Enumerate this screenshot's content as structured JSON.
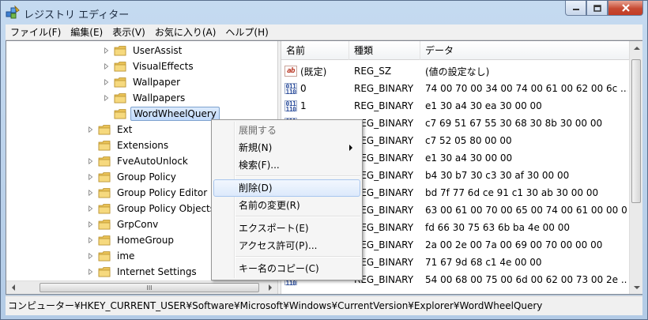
{
  "window": {
    "title": "レジストリ エディター",
    "close_icon": "close-icon",
    "min_icon": "minimize-icon",
    "max_icon": "maximize-icon"
  },
  "menubar": [
    "ファイル(F)",
    "編集(E)",
    "表示(V)",
    "お気に入り(A)",
    "ヘルプ(H)"
  ],
  "tree": {
    "items": [
      {
        "label": "UserAssist",
        "expandable": true,
        "level": 2
      },
      {
        "label": "VisualEffects",
        "expandable": true,
        "level": 2
      },
      {
        "label": "Wallpaper",
        "expandable": true,
        "level": 2
      },
      {
        "label": "Wallpapers",
        "expandable": true,
        "level": 2
      },
      {
        "label": "WordWheelQuery",
        "expandable": false,
        "level": 2,
        "selected": true
      },
      {
        "label": "Ext",
        "expandable": true,
        "level": 1
      },
      {
        "label": "Extensions",
        "expandable": false,
        "level": 1
      },
      {
        "label": "FveAutoUnlock",
        "expandable": true,
        "level": 1
      },
      {
        "label": "Group Policy",
        "expandable": true,
        "level": 1
      },
      {
        "label": "Group Policy Editor",
        "expandable": true,
        "level": 1
      },
      {
        "label": "Group Policy Objects",
        "expandable": true,
        "level": 1
      },
      {
        "label": "GrpConv",
        "expandable": true,
        "level": 1
      },
      {
        "label": "HomeGroup",
        "expandable": true,
        "level": 1
      },
      {
        "label": "ime",
        "expandable": true,
        "level": 1
      },
      {
        "label": "Internet Settings",
        "expandable": true,
        "level": 1
      }
    ],
    "hscroll_thumb_glyph": "III"
  },
  "list": {
    "columns": [
      "名前",
      "種類",
      "データ"
    ],
    "rows": [
      {
        "name": "(既定)",
        "type": "REG_SZ",
        "data": "(値の設定なし)",
        "icon": "string-value-icon"
      },
      {
        "name": "0",
        "type": "REG_BINARY",
        "data": "74 00 70 00 34 00 74 00 61 00 62 00 6c ...",
        "icon": "binary-value-icon"
      },
      {
        "name": "1",
        "type": "REG_BINARY",
        "data": "e1 30 a4 30 ea 30 00 00",
        "icon": "binary-value-icon"
      },
      {
        "name": "",
        "type": "REG_BINARY",
        "data": "c7 69 51 67 55 30 68 30 8b 30 00 00",
        "icon": "binary-value-icon"
      },
      {
        "name": "",
        "type": "REG_BINARY",
        "data": "c7 52 05 80 00 00",
        "icon": "binary-value-icon"
      },
      {
        "name": "",
        "type": "REG_BINARY",
        "data": "e1 30 a4 30 00 00",
        "icon": "binary-value-icon"
      },
      {
        "name": "",
        "type": "REG_BINARY",
        "data": "b4 30 b7 30 c3 30 af 30 00 00",
        "icon": "binary-value-icon"
      },
      {
        "name": "",
        "type": "REG_BINARY",
        "data": "bd 7f 77 6d ce 91 c1 30 ab 30 00 00",
        "icon": "binary-value-icon"
      },
      {
        "name": "",
        "type": "REG_BINARY",
        "data": "63 00 61 00 70 00 65 00 74 00 61 00 00 00",
        "icon": "binary-value-icon"
      },
      {
        "name": "",
        "type": "REG_BINARY",
        "data": "fd 66 30 75 63 6b ba 4e 00 00",
        "icon": "binary-value-icon"
      },
      {
        "name": "",
        "type": "REG_BINARY",
        "data": "2a 00 2e 00 7a 00 69 00 70 00 00 00",
        "icon": "binary-value-icon"
      },
      {
        "name": "",
        "type": "REG_BINARY",
        "data": "71 67 9d 68 c1 4e 00 00",
        "icon": "binary-value-icon"
      },
      {
        "name": "",
        "type": "REG_BINARY",
        "data": "54 00 68 00 75 00 6d 00 62 00 73 00 2e ...",
        "icon": "binary-value-icon"
      }
    ]
  },
  "context_menu": {
    "items": [
      {
        "label": "展開する",
        "disabled": true
      },
      {
        "label": "新規(N)",
        "submenu": true
      },
      {
        "label": "検索(F)..."
      },
      {
        "separator": true
      },
      {
        "label": "削除(D)",
        "hover": true
      },
      {
        "label": "名前の変更(R)"
      },
      {
        "separator": true
      },
      {
        "label": "エクスポート(E)"
      },
      {
        "label": "アクセス許可(P)..."
      },
      {
        "separator": true
      },
      {
        "label": "キー名のコピー(C)"
      }
    ]
  },
  "statusbar": {
    "path": "コンピューター¥HKEY_CURRENT_USER¥Software¥Microsoft¥Windows¥CurrentVersion¥Explorer¥WordWheelQuery"
  }
}
